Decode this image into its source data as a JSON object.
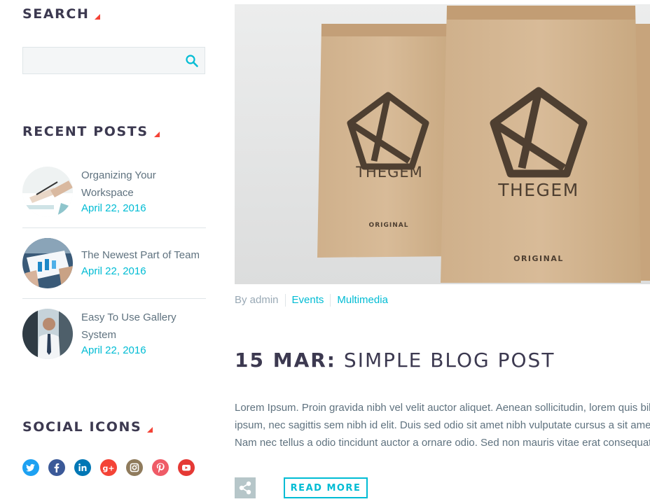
{
  "sidebar": {
    "search": {
      "title": "SEARCH",
      "placeholder": ""
    },
    "recent_posts": {
      "title": "RECENT POSTS",
      "items": [
        {
          "title": "Organizing Your Workspace",
          "date": "April 22, 2016",
          "thumb": "hands-writing-icon"
        },
        {
          "title": "The Newest Part of Team",
          "date": "April 22, 2016",
          "thumb": "tablet-chart-icon"
        },
        {
          "title": "Easy To Use Gallery System",
          "date": "April 22, 2016",
          "thumb": "businessman-icon"
        }
      ]
    },
    "social": {
      "title": "SOCIAL ICONS",
      "icons": [
        {
          "name": "twitter-icon",
          "color": "#1da1f2"
        },
        {
          "name": "facebook-icon",
          "color": "#3b5998"
        },
        {
          "name": "linkedin-icon",
          "color": "#0077b5"
        },
        {
          "name": "google-plus-icon",
          "color": "#f44336"
        },
        {
          "name": "instagram-icon",
          "color": "#8f7b5c"
        },
        {
          "name": "pinterest-icon",
          "color": "#ef5b67"
        },
        {
          "name": "youtube-icon",
          "color": "#e53935"
        }
      ]
    }
  },
  "post": {
    "image": {
      "bag_front_brand": "THEGEM",
      "bag_back_brand": "THEGEM",
      "bag_label": "ORIGINAL"
    },
    "meta": {
      "author": "By admin",
      "categories": [
        "Events",
        "Multimedia"
      ]
    },
    "title_date": "15 MAR:",
    "title_name": "SIMPLE BLOG POST",
    "excerpt_lines": [
      "Lorem Ipsum. Proin gravida nibh vel velit auctor aliquet. Aenean sollicitudin, lorem quis bibendum auctor,",
      "ipsum, nec sagittis sem nibh id elit. Duis sed odio sit amet nibh vulputate cursus a sit amet mauris. Morbi accumsan",
      "Nam nec tellus a odio tincidunt auctor a ornare odio. Sed non mauris vitae erat consequat auctor eu in elit."
    ],
    "read_more": "READ MORE"
  },
  "colors": {
    "accent": "#00bcd4",
    "heading": "#3c3950",
    "text": "#5f727f",
    "marker": "#f44336"
  }
}
